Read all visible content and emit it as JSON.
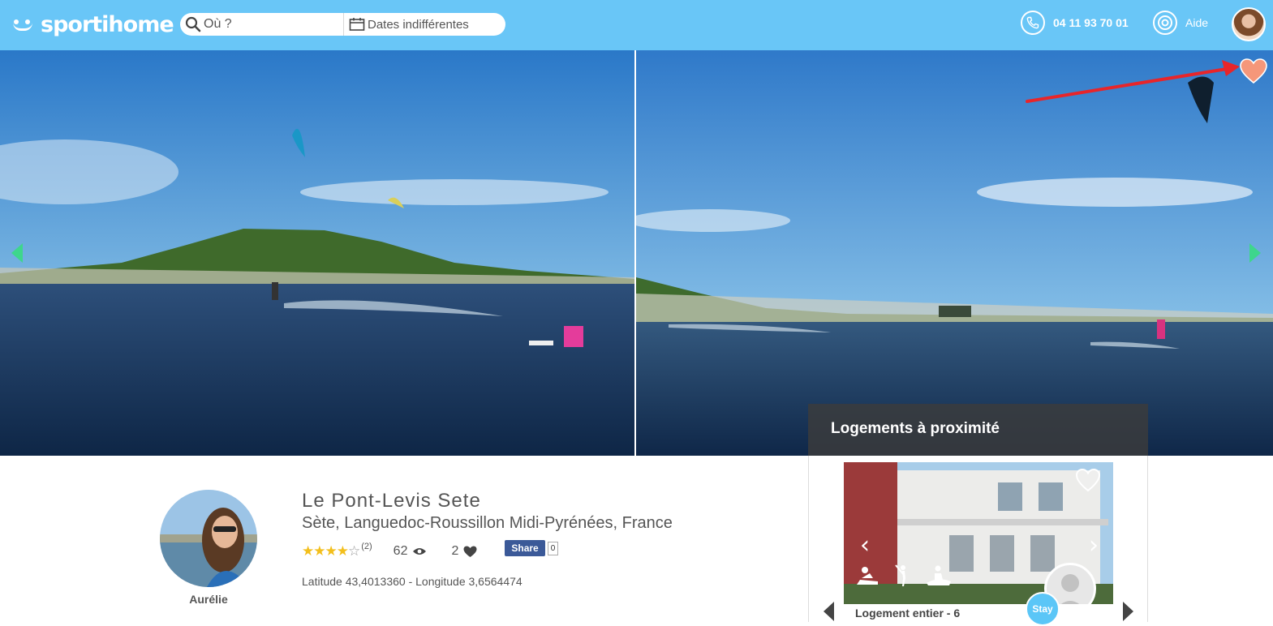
{
  "header": {
    "logo_text": "sportihome",
    "search_placeholder": "Où ?",
    "dates_label": "Dates indifférentes",
    "phone": "04 11 93 70 01",
    "help_label": "Aide"
  },
  "nearby": {
    "title": "Logements à proximité",
    "card": {
      "title": "Logement entier - 6",
      "badge": "Stay",
      "sport_icons": [
        "kitesurf-icon",
        "golf-icon",
        "jetski-icon"
      ]
    }
  },
  "listing": {
    "title": "Le Pont-Levis Sete",
    "location": "Sète, Languedoc-Roussillon Midi-Pyrénées, France",
    "rating": 4,
    "rating_max": 5,
    "review_count": "(2)",
    "views": "62",
    "likes": "2",
    "share_label": "Share",
    "share_count": "0",
    "coordinates": "Latitude 43,4013360 - Longitude 3,6564474",
    "host_name": "Aurélie"
  },
  "colors": {
    "topbar": "#69c6f7",
    "gallery_arrow": "#3ed68c",
    "favorite_heart": "#f5977a",
    "annotation_arrow": "#e8252a",
    "stars": "#f3bf1c",
    "facebook": "#3b5998"
  }
}
